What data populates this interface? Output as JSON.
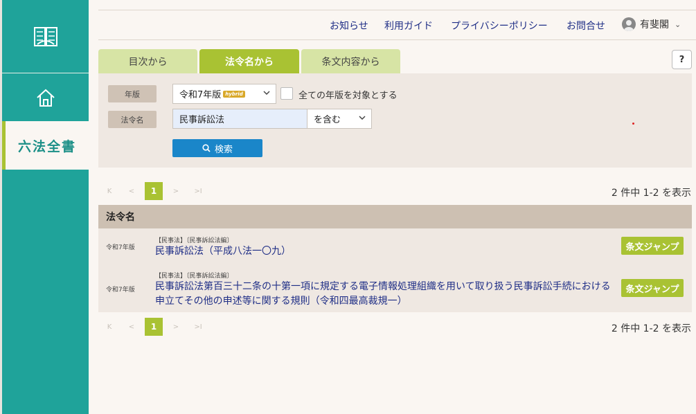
{
  "sidebar": {
    "roppo_label": "六法全書"
  },
  "header": {
    "nav": [
      "お知らせ",
      "利用ガイド",
      "プライバシーポリシー",
      "お問合せ"
    ],
    "user_name": "有斐閣"
  },
  "tabs": [
    {
      "label": "目次から",
      "active": false
    },
    {
      "label": "法令名から",
      "active": true
    },
    {
      "label": "条文内容から",
      "active": false
    }
  ],
  "help_label": "?",
  "search": {
    "edition_label": "年版",
    "edition_value": "令和7年版",
    "edition_badge": "hybrid",
    "all_editions_label": "全ての年版を対象とする",
    "law_name_label": "法令名",
    "law_name_value": "民事訴訟法",
    "match_value": "を含む",
    "search_button": "検索"
  },
  "pagination": {
    "current_page": "1",
    "first": "K",
    "prev": "<",
    "next": ">",
    "last": ">I",
    "count_text": "2 件中 1-2 を表示"
  },
  "results": {
    "header": "法令名",
    "rows": [
      {
        "edition": "令和7年版",
        "category": "【民事法】〔民事訴訟法編〕",
        "title": "民事訴訟法（平成八法一〇九）",
        "jump_label": "条文ジャンプ"
      },
      {
        "edition": "令和7年版",
        "category": "【民事法】〔民事訴訟法編〕",
        "title": "民事訴訟法第百三十二条の十第一項に規定する電子情報処理組織を用いて取り扱う民事訴訟手続における申立てその他の申述等に関する規則（令和四最高裁規一）",
        "jump_label": "条文ジャンプ"
      }
    ]
  },
  "colors": {
    "sidebar": "#1fa39a",
    "accent_green": "#a9c233",
    "link_blue": "#1f2e86",
    "search_button": "#1a86c9"
  }
}
